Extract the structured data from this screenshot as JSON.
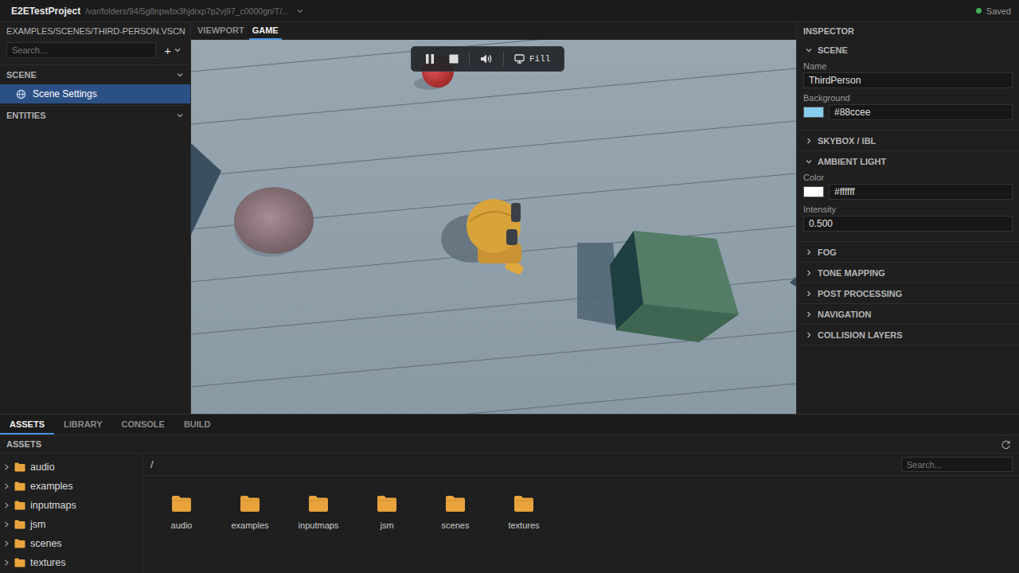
{
  "app": {
    "project": "E2ETestProject",
    "path": "/var/folders/94/5g8npwbx3hjdrxp7p2vj97_c0000gn/T/...",
    "status": "Saved"
  },
  "scene_file": "EXAMPLES/SCENES/THIRD-PERSON.VSCN",
  "view_tabs": [
    {
      "label": "VIEWPORT",
      "selected": false
    },
    {
      "label": "GAME",
      "selected": true
    }
  ],
  "hierarchy": {
    "search_placeholder": "Search...",
    "add_icon": "+",
    "sections": [
      {
        "title": "SCENE",
        "expanded": true,
        "items": [
          {
            "label": "Scene Settings",
            "selected": true
          }
        ]
      },
      {
        "title": "ENTITIES",
        "expanded": true,
        "items": []
      }
    ]
  },
  "game_toolbar": {
    "playing": true,
    "muted": false,
    "scale_mode": "Fill"
  },
  "inspector": {
    "title": "INSPECTOR",
    "sections": [
      {
        "title": "SCENE",
        "expanded": true,
        "fields": [
          {
            "label": "Name",
            "kind": "text",
            "value": "ThirdPerson"
          },
          {
            "label": "Background",
            "kind": "color",
            "value": "#88ccee"
          }
        ]
      },
      {
        "title": "SKYBOX / IBL",
        "expanded": false,
        "fields": []
      },
      {
        "title": "AMBIENT LIGHT",
        "expanded": true,
        "fields": [
          {
            "label": "Color",
            "kind": "color",
            "value": "#ffffff"
          },
          {
            "label": "Intensity",
            "kind": "text",
            "value": "0.500"
          }
        ]
      },
      {
        "title": "FOG",
        "expanded": false,
        "fields": []
      },
      {
        "title": "TONE MAPPING",
        "expanded": false,
        "fields": []
      },
      {
        "title": "POST PROCESSING",
        "expanded": false,
        "fields": []
      },
      {
        "title": "NAVIGATION",
        "expanded": false,
        "fields": []
      },
      {
        "title": "COLLISION LAYERS",
        "expanded": false,
        "fields": []
      }
    ]
  },
  "bottom_tabs": [
    {
      "label": "ASSETS",
      "selected": true
    },
    {
      "label": "LIBRARY",
      "selected": false
    },
    {
      "label": "CONSOLE",
      "selected": false
    },
    {
      "label": "BUILD",
      "selected": false
    }
  ],
  "assets": {
    "title": "ASSETS",
    "breadcrumb": "/",
    "search_placeholder": "Search...",
    "tree": [
      {
        "name": "audio",
        "expanded": false
      },
      {
        "name": "examples",
        "expanded": false
      },
      {
        "name": "inputmaps",
        "expanded": false
      },
      {
        "name": "jsm",
        "expanded": false
      },
      {
        "name": "scenes",
        "expanded": false
      },
      {
        "name": "textures",
        "expanded": false
      }
    ],
    "items": [
      {
        "name": "audio"
      },
      {
        "name": "examples"
      },
      {
        "name": "inputmaps"
      },
      {
        "name": "jsm"
      },
      {
        "name": "scenes"
      },
      {
        "name": "textures"
      }
    ]
  }
}
